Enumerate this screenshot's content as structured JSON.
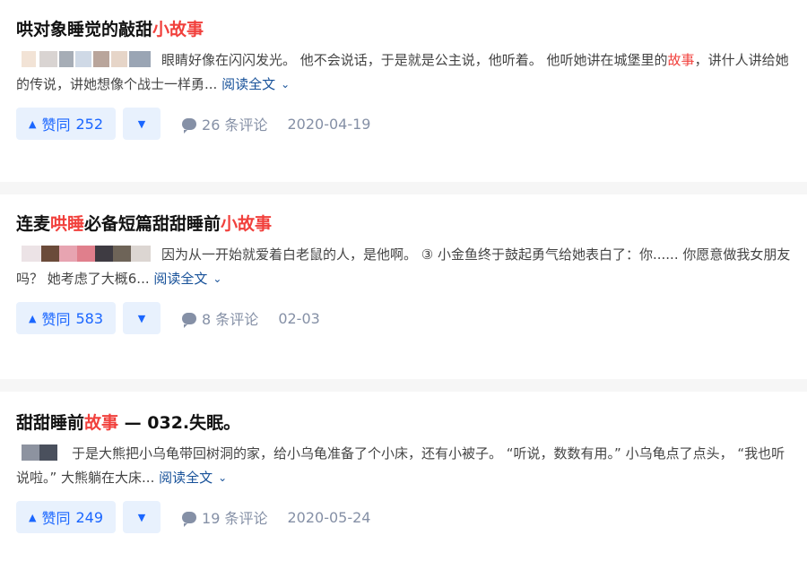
{
  "items": [
    {
      "title_parts": [
        "哄对象睡觉的敲甜",
        "小故事"
      ],
      "excerpt_parts": [
        "眼睛好像在闪闪发光。 他不会说话，于是就是公主说，他听着。 他听她讲在城堡里的",
        "故事",
        "，讲什人讲给她的传说，讲她想像个战士一样勇... "
      ],
      "read_more": "阅读全文",
      "upvote_label": "赞同",
      "upvote_count": "252",
      "comments": "26 条评论",
      "date": "2020-04-19"
    },
    {
      "title_parts": [
        "连麦",
        "哄睡",
        "必备短篇甜甜睡前",
        "小故事"
      ],
      "excerpt_parts": [
        "因为从一开始就爱着白老鼠的人，是他啊。 ③ 小金鱼终于鼓起勇气给她表白了：你...... 你愿意做我女朋友吗？ 她考虑了大概6... "
      ],
      "read_more": "阅读全文",
      "upvote_label": "赞同",
      "upvote_count": "583",
      "comments": "8 条评论",
      "date": "02-03"
    },
    {
      "title_parts": [
        "甜甜睡前",
        "故事",
        " — 032.失眠。"
      ],
      "excerpt_parts": [
        "于是大熊把小乌龟带回树洞的家，给小乌龟准备了个小床，还有小被子。 “听说，数数有用。” 小乌龟点了点头， “我也听说啦。” 大熊躺在大床... "
      ],
      "read_more": "阅读全文",
      "upvote_label": "赞同",
      "upvote_count": "249",
      "comments": "19 条评论",
      "date": "2020-05-24"
    }
  ],
  "colors": {
    "accent": "#1a66ff",
    "highlight": "#f1403c",
    "meta": "#8590a6",
    "link": "#175199"
  }
}
